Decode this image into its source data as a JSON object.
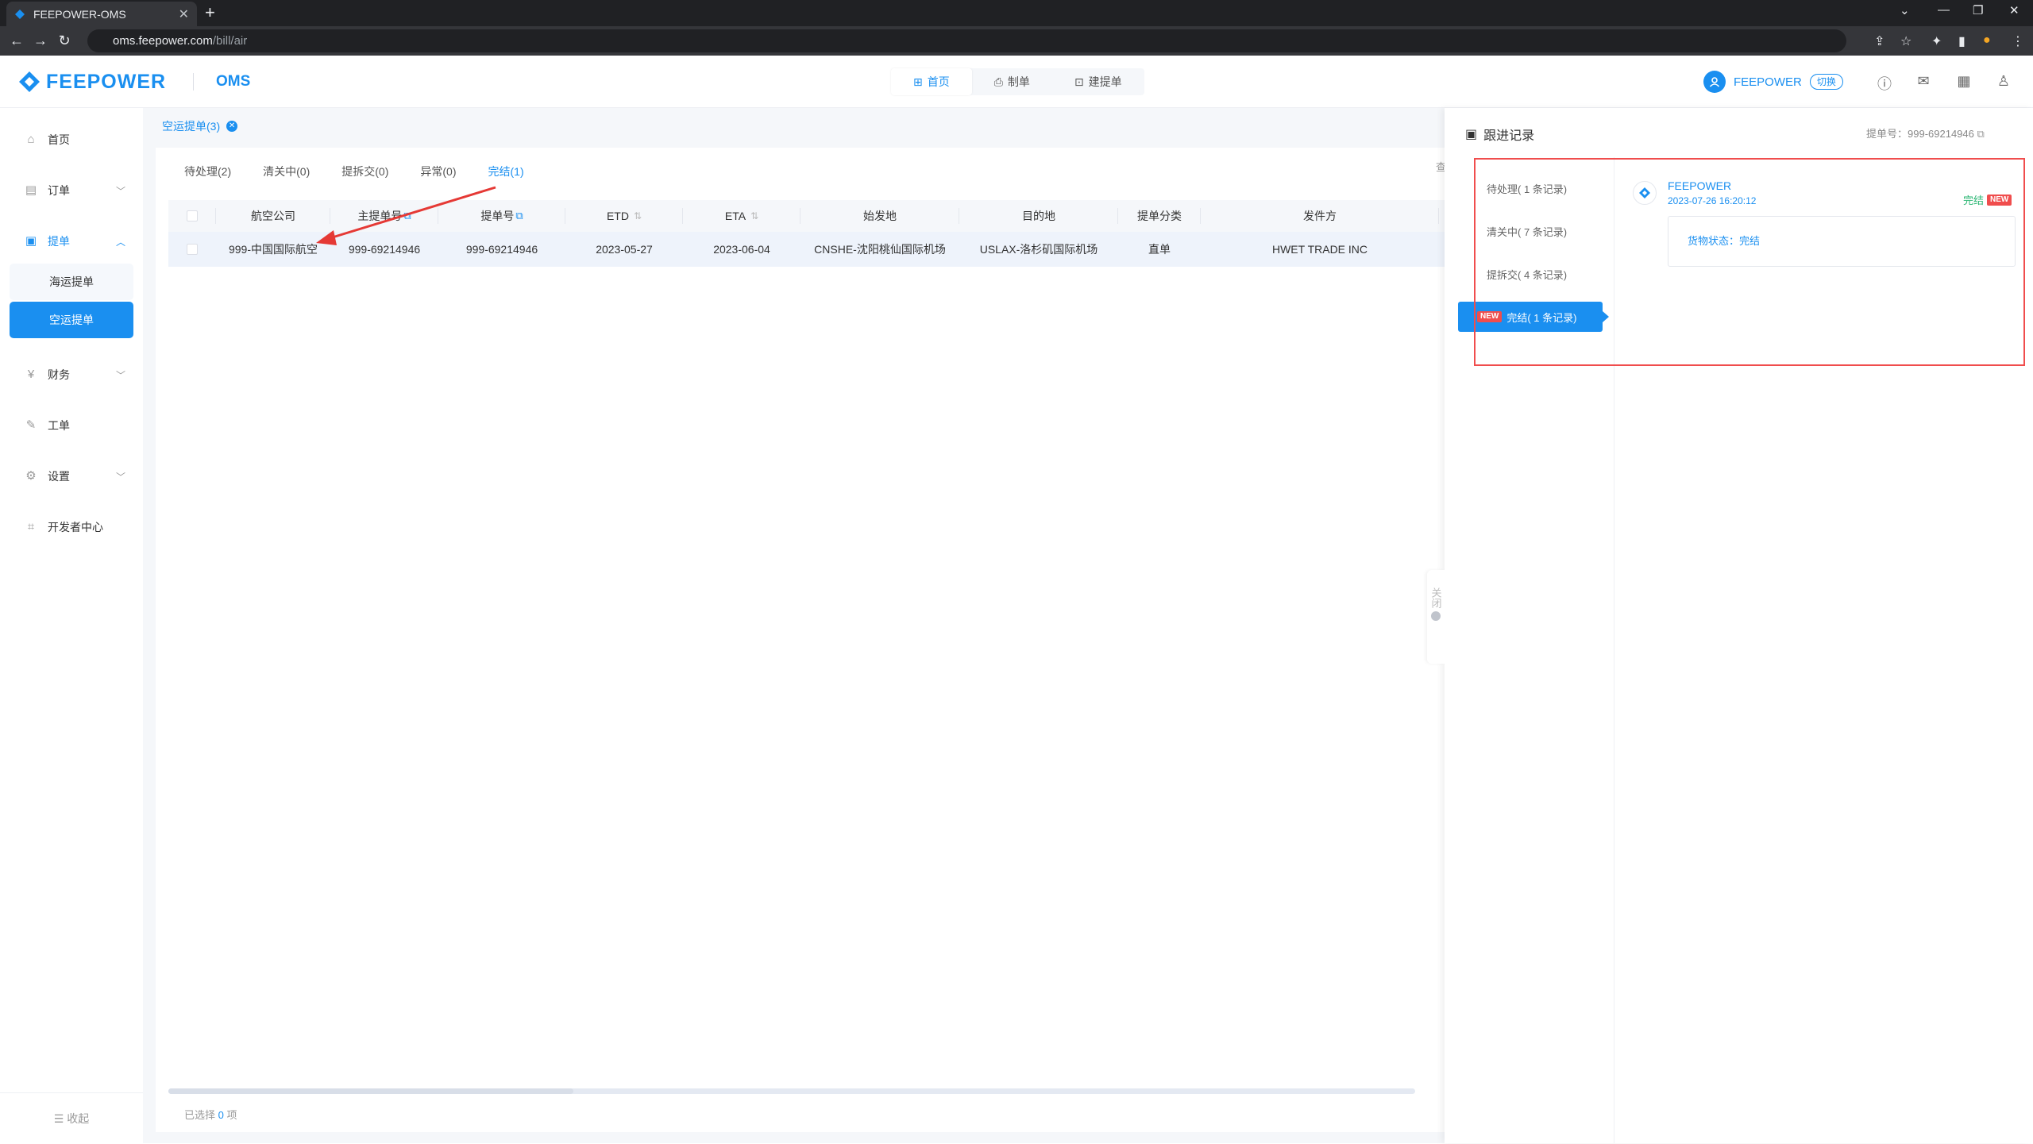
{
  "browser": {
    "tab_title": "FEEPOWER-OMS",
    "url_host": "oms.feepower.com",
    "url_path": "/bill/air"
  },
  "header": {
    "logo": "FEEPOWER",
    "product": "OMS",
    "nav": [
      "首页",
      "制单",
      "建提单"
    ],
    "user": "FEEPOWER",
    "switch_label": "切换"
  },
  "sidebar": {
    "items": [
      {
        "label": "首页",
        "icon": "home-icon"
      },
      {
        "label": "订单",
        "icon": "order-icon"
      },
      {
        "label": "提单",
        "icon": "bill-icon"
      },
      {
        "label": "财务",
        "icon": "finance-icon"
      },
      {
        "label": "工单",
        "icon": "ticket-icon"
      },
      {
        "label": "设置",
        "icon": "settings-icon"
      },
      {
        "label": "开发者中心",
        "icon": "developer-icon"
      }
    ],
    "sub_items": [
      "海运提单",
      "空运提单"
    ],
    "collapse": "收起"
  },
  "page": {
    "tab": "空运提单(3)",
    "status_tabs": [
      "待处理(2)",
      "清关中(0)",
      "提拆交(0)",
      "异常(0)",
      "完结(1)"
    ],
    "columns": [
      "航空公司",
      "主提单号",
      "提单号",
      "ETD",
      "ETA",
      "始发地",
      "目的地",
      "提单分类",
      "发件方"
    ],
    "rows": [
      {
        "airline": "999-中国国际航空",
        "master_no": "999-69214946",
        "bill_no": "999-69214946",
        "etd": "2023-05-27",
        "eta": "2023-06-04",
        "origin": "CNSHE-沈阳桃仙国际机场",
        "dest": "USLAX-洛杉矶国际机场",
        "type": "直单",
        "shipper": "HWET TRADE INC"
      }
    ],
    "selected_prefix": "已选择",
    "selected_count": "0",
    "selected_suffix": "项"
  },
  "drawer": {
    "title": "跟进记录",
    "bill_label": "提单号：999-69214946",
    "statuses": [
      "待处理( 1 条记录)",
      "清关中( 7 条记录)",
      "提拆交( 4 条记录)",
      "完结( 1 条记录)"
    ],
    "new_badge": "NEW",
    "entry": {
      "name": "FEEPOWER",
      "time": "2023-07-26 16:20:12",
      "status": "完结",
      "badge": "NEW",
      "detail": "货物状态：完结"
    },
    "close_label": "关闭"
  }
}
